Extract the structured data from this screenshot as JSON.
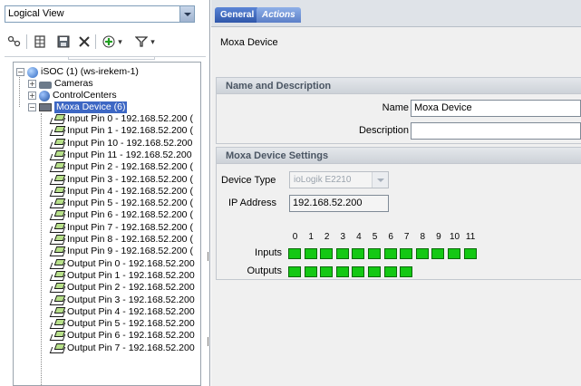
{
  "left": {
    "view_select": "Logical View",
    "toolbar": {
      "icons": [
        "link-icon",
        "grid-icon",
        "save-icon",
        "close-icon",
        "add-icon",
        "filter-icon"
      ]
    },
    "tree": {
      "root": "iSOC (1) (ws-irekem-1)",
      "nodes": [
        "Cameras",
        "ControlCenters",
        "Moxa Device (6)"
      ],
      "pins": [
        "Input Pin 0 - 192.168.52.200 (",
        "Input Pin 1 - 192.168.52.200 (",
        "Input Pin 10 - 192.168.52.200",
        "Input Pin 11 - 192.168.52.200",
        "Input Pin 2 - 192.168.52.200 (",
        "Input Pin 3 - 192.168.52.200 (",
        "Input Pin 4 - 192.168.52.200 (",
        "Input Pin 5 - 192.168.52.200 (",
        "Input Pin 6 - 192.168.52.200 (",
        "Input Pin 7 - 192.168.52.200 (",
        "Input Pin 8 - 192.168.52.200 (",
        "Input Pin 9 - 192.168.52.200 (",
        "Output Pin 0 - 192.168.52.200",
        "Output Pin 1 - 192.168.52.200",
        "Output Pin 2 - 192.168.52.200",
        "Output Pin 3 - 192.168.52.200",
        "Output Pin 4 - 192.168.52.200",
        "Output Pin 5 - 192.168.52.200",
        "Output Pin 6 - 192.168.52.200",
        "Output Pin 7 - 192.168.52.200"
      ]
    }
  },
  "right": {
    "tabs": [
      "General",
      "Actions"
    ],
    "device_title": "Moxa Device",
    "name_section": {
      "header": "Name and Description",
      "name_label": "Name",
      "name_value": "Moxa Device",
      "description_label": "Description",
      "description_value": ""
    },
    "settings_section": {
      "header": "Moxa Device Settings",
      "device_type_label": "Device Type",
      "device_type_value": "ioLogik E2210",
      "ip_label": "IP Address",
      "ip_value": "192.168.52.200",
      "inputs_label": "Inputs",
      "outputs_label": "Outputs",
      "pin_numbers": [
        "0",
        "1",
        "2",
        "3",
        "4",
        "5",
        "6",
        "7",
        "8",
        "9",
        "10",
        "11"
      ],
      "input_count": 12,
      "output_count": 8,
      "active_color": "#14c814"
    }
  }
}
